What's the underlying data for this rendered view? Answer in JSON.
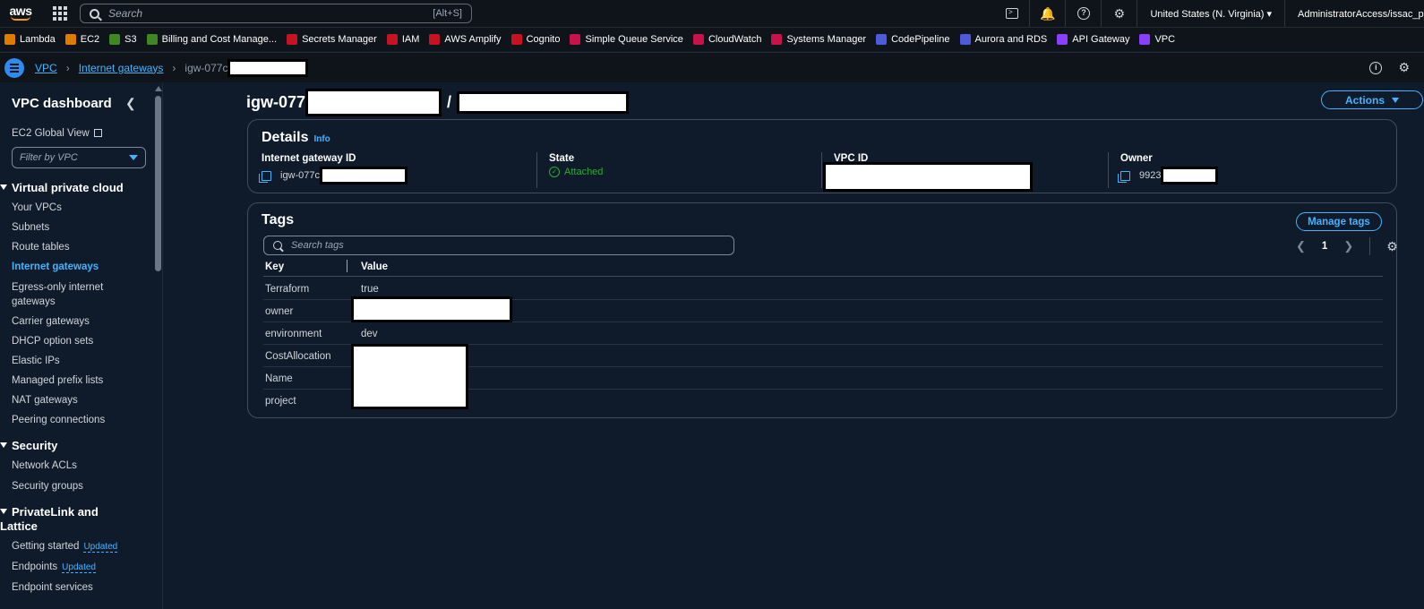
{
  "topnav": {
    "logo": "aws",
    "search_placeholder": "Search",
    "search_shortcut": "[Alt+S]",
    "region": "United States (N. Virginia) ▾",
    "account": "AdministratorAccess/issac_pac ▾",
    "icons": [
      "cloudshell-icon",
      "bell-icon",
      "help-icon",
      "gear-icon"
    ]
  },
  "favorites": [
    {
      "label": "Lambda",
      "color": "#e07b00"
    },
    {
      "label": "EC2",
      "color": "#e07b00"
    },
    {
      "label": "S3",
      "color": "#3f8624"
    },
    {
      "label": "Billing and Cost Manage...",
      "color": "#3f8624"
    },
    {
      "label": "Secrets Manager",
      "color": "#c7131f"
    },
    {
      "label": "IAM",
      "color": "#c7131f"
    },
    {
      "label": "AWS Amplify",
      "color": "#c7131f"
    },
    {
      "label": "Cognito",
      "color": "#c7131f"
    },
    {
      "label": "Simple Queue Service",
      "color": "#c7134a"
    },
    {
      "label": "CloudWatch",
      "color": "#c7134a"
    },
    {
      "label": "Systems Manager",
      "color": "#c7134a"
    },
    {
      "label": "CodePipeline",
      "color": "#4d5bd8"
    },
    {
      "label": "Aurora and RDS",
      "color": "#4d5bd8"
    },
    {
      "label": "API Gateway",
      "color": "#8a3ffc"
    },
    {
      "label": "VPC",
      "color": "#8a3ffc"
    }
  ],
  "breadcrumb": {
    "root": "VPC",
    "parent": "Internet gateways",
    "current": "igw-077c"
  },
  "sidebar": {
    "title": "VPC dashboard",
    "global_view": "EC2 Global View",
    "filter_placeholder": "Filter by VPC",
    "sections": {
      "vpc": "Virtual private cloud",
      "security": "Security",
      "privatelink": "PrivateLink and Lattice"
    },
    "items": {
      "your_vpcs": "Your VPCs",
      "subnets": "Subnets",
      "route_tables": "Route tables",
      "internet_gateways": "Internet gateways",
      "egress_only": "Egress-only internet",
      "egress_only_2": "gateways",
      "carrier": "Carrier gateways",
      "dhcp": "DHCP option sets",
      "elastic_ips": "Elastic IPs",
      "prefix_lists": "Managed prefix lists",
      "nat": "NAT gateways",
      "peering": "Peering connections",
      "nacls": "Network ACLs",
      "security_groups": "Security groups",
      "getting_started": "Getting started",
      "endpoints": "Endpoints",
      "endpoint_services": "Endpoint services"
    },
    "badge": "Updated"
  },
  "main": {
    "title": "igw-077",
    "title_sep": "/",
    "actions": "Actions"
  },
  "details": {
    "heading": "Details",
    "info": "Info",
    "igw_label": "Internet gateway ID",
    "igw_value": "igw-077c",
    "state_label": "State",
    "state_value": "Attached",
    "vpc_label": "VPC ID",
    "owner_label": "Owner",
    "owner_value": "9923"
  },
  "tags": {
    "heading": "Tags",
    "manage": "Manage tags",
    "search_placeholder": "Search tags",
    "page": "1",
    "col_key": "Key",
    "col_value": "Value",
    "rows": [
      {
        "key": "Terraform",
        "value": "true"
      },
      {
        "key": "owner",
        "value": ""
      },
      {
        "key": "environment",
        "value": "dev"
      },
      {
        "key": "CostAllocation",
        "value": ""
      },
      {
        "key": "Name",
        "value": ""
      },
      {
        "key": "project",
        "value": ""
      }
    ]
  }
}
